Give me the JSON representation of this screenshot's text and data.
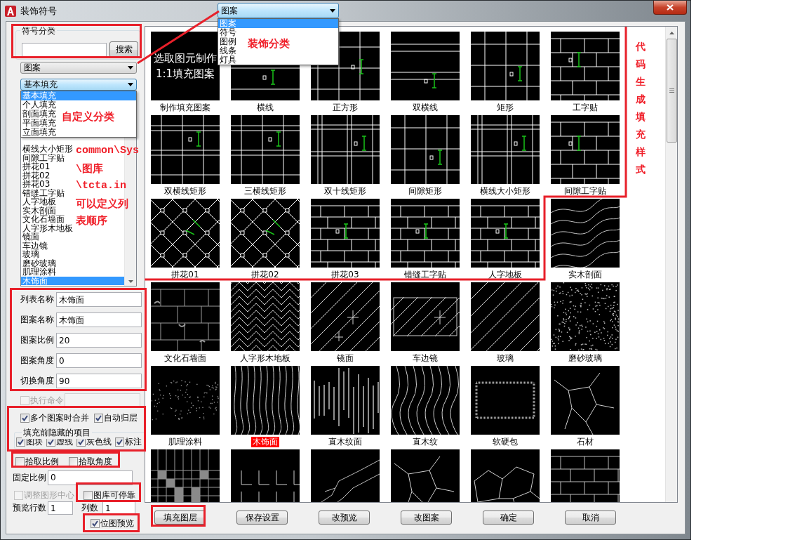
{
  "window": {
    "title": "装饰符号"
  },
  "category_group": {
    "title": "符号分类",
    "search_button": "搜索"
  },
  "category_combo": {
    "value": "图案"
  },
  "subcategory_combo": {
    "value": "基本填充",
    "expanded": true,
    "options": [
      {
        "label": "基本填充",
        "selected": true
      },
      {
        "label": "个人填充",
        "selected": false
      },
      {
        "label": "剖面填充",
        "selected": false
      },
      {
        "label": "平面填充",
        "selected": false
      },
      {
        "label": "立面填充",
        "selected": false
      }
    ]
  },
  "pattern_list": [
    {
      "label": "横线大小矩形",
      "selected": false
    },
    {
      "label": "间隙工字贴",
      "selected": false
    },
    {
      "label": "拼花01",
      "selected": false
    },
    {
      "label": "拼花02",
      "selected": false
    },
    {
      "label": "拼花03",
      "selected": false
    },
    {
      "label": "错缝工字贴",
      "selected": false
    },
    {
      "label": "人字地板",
      "selected": false
    },
    {
      "label": "实木剖面",
      "selected": false
    },
    {
      "label": "文化石墙面",
      "selected": false
    },
    {
      "label": "人字形木地板",
      "selected": false
    },
    {
      "label": "镜面",
      "selected": false
    },
    {
      "label": "车边镜",
      "selected": false
    },
    {
      "label": "玻璃",
      "selected": false
    },
    {
      "label": "磨砂玻璃",
      "selected": false
    },
    {
      "label": "肌理涂料",
      "selected": false
    },
    {
      "label": "木饰面",
      "selected": true
    }
  ],
  "floating_combo": {
    "value": "图案",
    "expanded": true,
    "options": [
      {
        "label": "图案",
        "selected": true
      },
      {
        "label": "符号",
        "selected": false
      },
      {
        "label": "图例",
        "selected": false
      },
      {
        "label": "线条",
        "selected": false
      },
      {
        "label": "灯具",
        "selected": false
      }
    ]
  },
  "fields": [
    {
      "label": "列表名称",
      "value": "木饰面"
    },
    {
      "label": "图案名称",
      "value": "木饰面"
    },
    {
      "label": "图案比例",
      "value": "20"
    },
    {
      "label": "图案角度",
      "value": "0"
    },
    {
      "label": "切换角度",
      "value": "90"
    }
  ],
  "execute_command": {
    "label": "执行命令",
    "checked": false,
    "disabled": true
  },
  "merge_options": [
    {
      "label": "多个图案时合并",
      "checked": true,
      "disabled": false
    },
    {
      "label": "自动归层",
      "checked": true,
      "disabled": false
    }
  ],
  "hide_group": {
    "title": "填充前隐藏的项目",
    "items": [
      {
        "label": "图块",
        "checked": true,
        "disabled": false
      },
      {
        "label": "虚线",
        "checked": true,
        "disabled": false
      },
      {
        "label": "灰色线",
        "checked": true,
        "disabled": false
      },
      {
        "label": "标注",
        "checked": true,
        "disabled": false
      }
    ]
  },
  "pick_options": [
    {
      "label": "拾取比例",
      "checked": false,
      "disabled": false
    },
    {
      "label": "拾取角度",
      "checked": false,
      "disabled": false
    }
  ],
  "fixed_scale": {
    "label": "固定比例",
    "value": "0"
  },
  "adjust_center": {
    "label": "调整图形中心",
    "checked": false,
    "disabled": true
  },
  "dockable": {
    "label": "图库可停靠",
    "checked": false,
    "disabled": false
  },
  "preview_rows": {
    "label": "预览行数",
    "value": "1"
  },
  "preview_cols": {
    "label": "列数",
    "value": "1"
  },
  "bitmap_preview": {
    "label": "位图预览",
    "checked": true,
    "disabled": false
  },
  "hatches": [
    {
      "kind": "text",
      "label": "制作填充图案",
      "selected": false,
      "preview_text": [
        "选取图元制作",
        "1:1填充图案"
      ]
    },
    {
      "kind": "hl",
      "label": "横线",
      "selected": false
    },
    {
      "kind": "grid",
      "label": "正方形",
      "selected": false
    },
    {
      "kind": "dhl",
      "label": "双横线",
      "selected": false
    },
    {
      "kind": "grid2",
      "label": "矩形",
      "selected": false
    },
    {
      "kind": "brick",
      "label": "工字贴",
      "selected": false
    },
    {
      "kind": "grid3",
      "label": "双横线矩形",
      "selected": false
    },
    {
      "kind": "grid3",
      "label": "三横线矩形",
      "selected": false
    },
    {
      "kind": "grid4",
      "label": "双十线矩形",
      "selected": false
    },
    {
      "kind": "grid2",
      "label": "间隙矩形",
      "selected": false
    },
    {
      "kind": "grid4",
      "label": "横线大小矩形",
      "selected": false
    },
    {
      "kind": "brick",
      "label": "间隙工字贴",
      "selected": false
    },
    {
      "kind": "diamond",
      "label": "拼花01",
      "selected": false
    },
    {
      "kind": "diamond",
      "label": "拼花02",
      "selected": false
    },
    {
      "kind": "brick3",
      "label": "拼花03",
      "selected": false
    },
    {
      "kind": "brick3",
      "label": "错缝工字贴",
      "selected": false
    },
    {
      "kind": "brick3",
      "label": "人字地板",
      "selected": false
    },
    {
      "kind": "wave",
      "label": "实木剖面",
      "selected": false
    },
    {
      "kind": "stone",
      "label": "文化石墙面",
      "selected": false
    },
    {
      "kind": "herring",
      "label": "人字形木地板",
      "selected": false
    },
    {
      "kind": "mirror",
      "label": "镜面",
      "selected": false
    },
    {
      "kind": "mframe",
      "label": "车边镜",
      "selected": false
    },
    {
      "kind": "diag",
      "label": "玻璃",
      "selected": false
    },
    {
      "kind": "noise",
      "label": "磨砂玻璃",
      "selected": false
    },
    {
      "kind": "dots",
      "label": "肌理涂料",
      "selected": false
    },
    {
      "kind": "vwave",
      "label": "木饰面",
      "selected": true
    },
    {
      "kind": "vlines",
      "label": "直木纹面",
      "selected": false
    },
    {
      "kind": "wood",
      "label": "直木纹",
      "selected": false
    },
    {
      "kind": "frame",
      "label": "软硬包",
      "selected": false
    },
    {
      "kind": "crack",
      "label": "石材",
      "selected": false
    },
    {
      "kind": "tiles"
    },
    {
      "kind": "ell"
    },
    {
      "kind": "crack2"
    },
    {
      "kind": "crack"
    },
    {
      "kind": "poly"
    },
    {
      "kind": "brick4"
    }
  ],
  "buttons": [
    "填充图层",
    "保存设置",
    "改预览",
    "改图案",
    "确定",
    "取消"
  ],
  "annotations": [
    {
      "text": "装饰分类"
    },
    {
      "text": "自定义分类"
    },
    {
      "text": "common\\Sys"
    },
    {
      "text": "\\图库"
    },
    {
      "text": "\\tcta.in"
    },
    {
      "text": "可以定义列"
    },
    {
      "text": "表顺序"
    },
    {
      "text": "代码生成填充样式"
    }
  ]
}
